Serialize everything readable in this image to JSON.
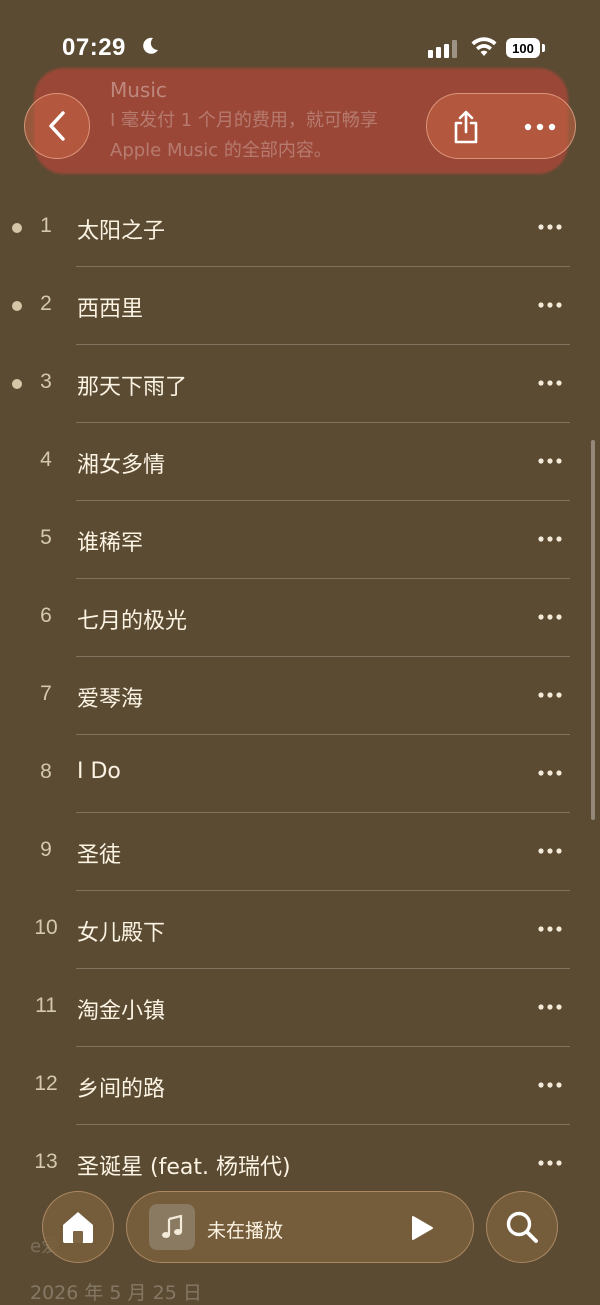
{
  "status_bar": {
    "time": "07:29",
    "battery": "100"
  },
  "banner": {
    "title": "Music",
    "body": "I 毫发付 1 个月的费用，就可畅享 Apple Music 的全部内容。"
  },
  "tracks": [
    {
      "num": "1",
      "title": "太阳之子",
      "downloaded": true
    },
    {
      "num": "2",
      "title": "西西里",
      "downloaded": true
    },
    {
      "num": "3",
      "title": "那天下雨了",
      "downloaded": true
    },
    {
      "num": "4",
      "title": "湘女多情",
      "downloaded": false
    },
    {
      "num": "5",
      "title": "谁稀罕",
      "downloaded": false
    },
    {
      "num": "6",
      "title": "七月的极光",
      "downloaded": false
    },
    {
      "num": "7",
      "title": "爱琴海",
      "downloaded": false
    },
    {
      "num": "8",
      "title": "I Do",
      "downloaded": false
    },
    {
      "num": "9",
      "title": "圣徒",
      "downloaded": false
    },
    {
      "num": "10",
      "title": "女儿殿下",
      "downloaded": false
    },
    {
      "num": "11",
      "title": "淘金小镇",
      "downloaded": false
    },
    {
      "num": "12",
      "title": "乡间的路",
      "downloaded": false
    },
    {
      "num": "13",
      "title": "圣诞星 (feat. 杨瑞代)",
      "downloaded": false
    }
  ],
  "footer": {
    "label": "e爱",
    "date": "2026 年 5 月 25 日"
  },
  "player": {
    "status": "未在播放"
  },
  "colors": {
    "background": "#5b4b32",
    "accent": "#c86446",
    "text": "#fbf3e3"
  },
  "icons": {
    "back": "chevron-left-icon",
    "share": "share-icon",
    "more": "ellipsis-icon",
    "home": "home-icon",
    "music": "music-note-icon",
    "play": "play-icon",
    "search": "search-icon"
  }
}
